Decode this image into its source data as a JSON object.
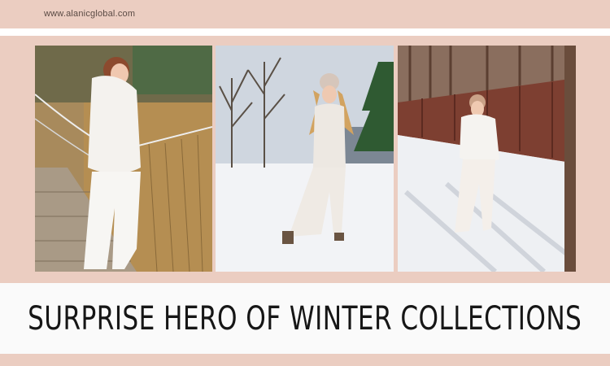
{
  "header": {
    "url": "www.alanicglobal.com"
  },
  "headline": {
    "text": "SURPRISE HERO OF WINTER COLLECTIONS"
  },
  "colors": {
    "background": "#ebcdc1",
    "title_bar": "#fafafa",
    "headline_text": "#161616"
  },
  "photos": [
    {
      "id": "photo-suspension-bridge"
    },
    {
      "id": "photo-snowy-field"
    },
    {
      "id": "photo-snowy-fence"
    }
  ]
}
